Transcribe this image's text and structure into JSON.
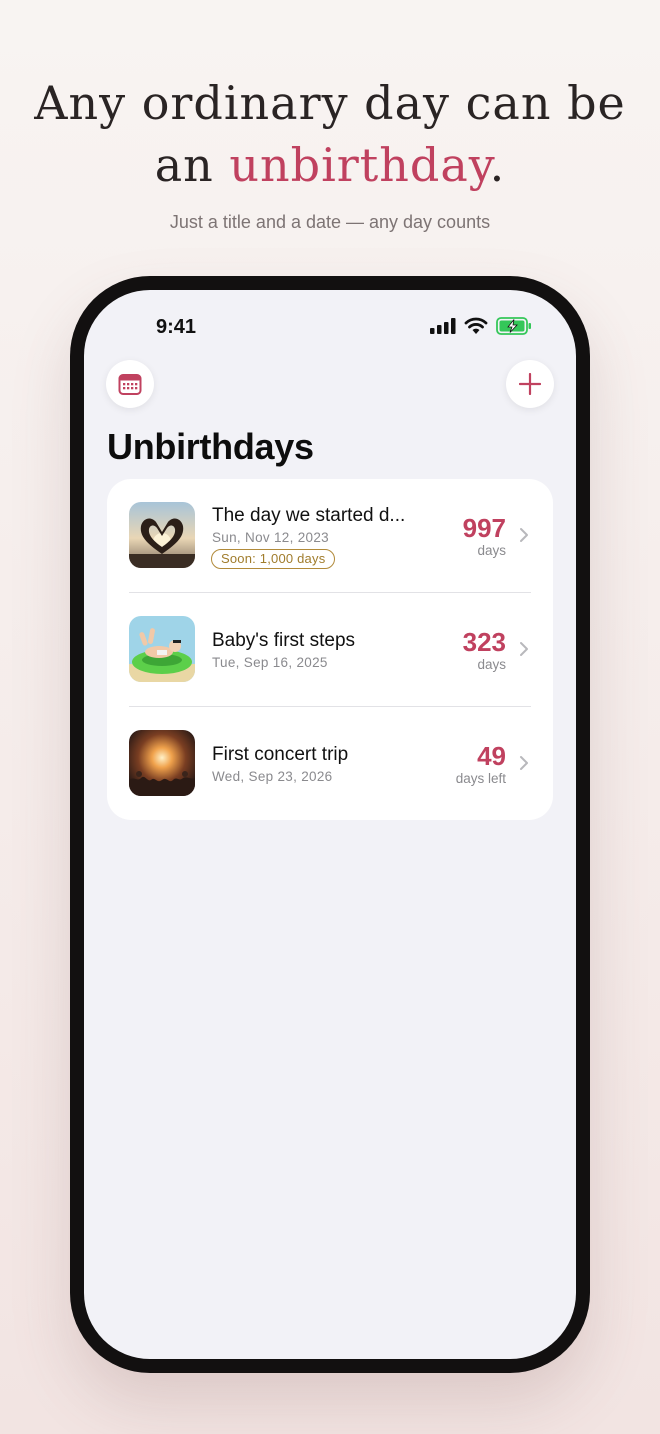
{
  "headline": {
    "line1": "Any ordinary day can be",
    "line2_prefix": "an ",
    "line2_accent": "unbirthday",
    "line2_suffix": "."
  },
  "subline": "Just a title and a date — any day counts",
  "status_bar": {
    "time": "9:41",
    "icons": [
      "cellular-signal-icon",
      "wifi-icon",
      "battery-charging-icon"
    ]
  },
  "toolbar": {
    "left_icon": "calendar-icon",
    "right_icon": "plus-icon"
  },
  "screen_title": "Unbirthdays",
  "colors": {
    "accent": "#c0415f",
    "badge": "#a07c2c",
    "battery": "#34c759"
  },
  "items": [
    {
      "title": "The day we started d...",
      "date": "Sun, Nov 12, 2023",
      "badge": "Soon: 1,000 days",
      "count": "997",
      "unit": "days",
      "thumb_icon": "heart-hands-photo"
    },
    {
      "title": "Baby's first steps",
      "date": "Tue, Sep 16, 2025",
      "count": "323",
      "unit": "days",
      "thumb_icon": "baby-float-photo"
    },
    {
      "title": "First concert trip",
      "date": "Wed, Sep 23, 2026",
      "count": "49",
      "unit": "days left",
      "thumb_icon": "concert-photo"
    }
  ]
}
